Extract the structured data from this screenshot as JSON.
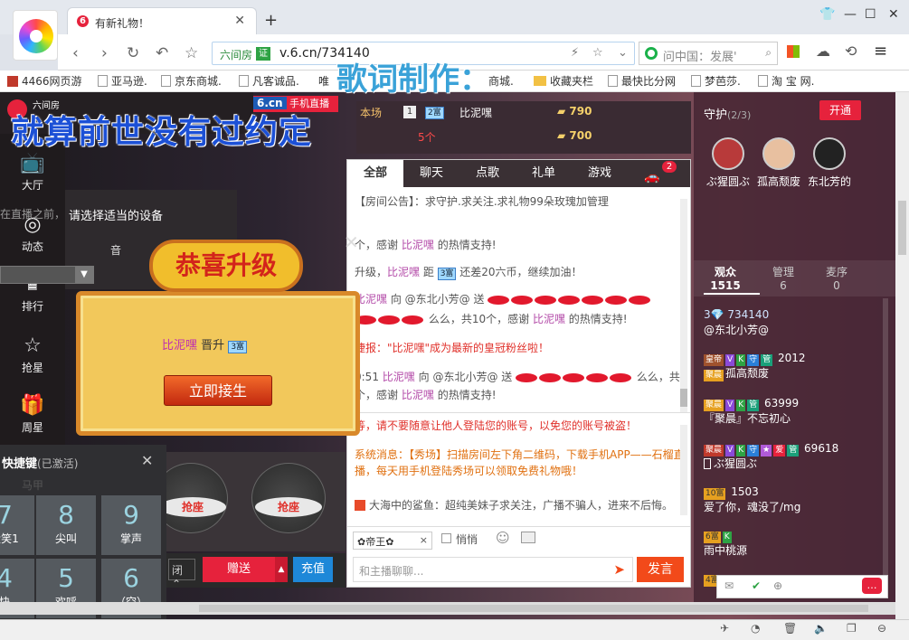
{
  "browser": {
    "tab_title": "有新礼物！",
    "tab_favicon": "6",
    "new_tab": "+",
    "url_site": "六间房",
    "url_cert": "证",
    "url": "v.6.cn/734140",
    "search_placeholder": "问中国：发展'",
    "bookmarks": [
      "4466网页游",
      "亚马逊.",
      "京东商城.",
      "凡客诚品.",
      "唯",
      "商城.",
      "收藏夹栏",
      "最快比分网",
      "梦芭莎.",
      "淘 宝 网."
    ]
  },
  "overlay": {
    "lyric_line": "就算前世没有过约定",
    "lyric_title": "歌词制作："
  },
  "brand": {
    "name": "6.cn",
    "tag": "手机直播",
    "room_label": "六间房"
  },
  "rank": {
    "label1": "本场",
    "pos": "1",
    "level_badge": "2富",
    "user": "比泥嘿",
    "gold1": "790",
    "label2": "5个",
    "gold2": "700"
  },
  "sidebar": [
    {
      "icon": "tv-icon",
      "glyph": "📺",
      "label": "大厅"
    },
    {
      "icon": "compass-icon",
      "glyph": "◎",
      "label": "动态"
    },
    {
      "icon": "crown-icon",
      "glyph": "♛",
      "label": "排行"
    },
    {
      "icon": "star-icon",
      "glyph": "☆",
      "label": "抢星"
    },
    {
      "icon": "gift-icon",
      "glyph": "🎁",
      "label": "周星"
    }
  ],
  "device_prompt": {
    "text": "请选择适当的设备",
    "hint": "在直播之前，",
    "label1": "音"
  },
  "chat_tabs": [
    "全部",
    "聊天",
    "点歌",
    "礼单",
    "游戏"
  ],
  "chat_badge": "2",
  "messages": [
    {
      "cls": "",
      "text": "【房间公告】：求守护.求关注.求礼物99朵玫瑰加管理"
    },
    {
      "cls": "",
      "pre": "个，感谢",
      "user": "比泥嘿",
      "post": "的热情支持!"
    },
    {
      "cls": "",
      "pre": "升级，",
      "user": "比泥嘿",
      "mid": "距",
      "lv": "3富",
      "post": "还差20六币，继续加油！"
    },
    {
      "cls": "",
      "user": "比泥嘿",
      "mid": "向 @东北小芳@ 送",
      "lips": 7,
      "post": ""
    },
    {
      "cls": "",
      "lips": 3,
      "pre": "么么，共10个，感谢",
      "user": "比泥嘿",
      "post": "的热情支持!"
    },
    {
      "cls": "red",
      "pre": "捷报：\"比泥嘿\"成为最新的皇冠粉丝啦！"
    },
    {
      "cls": "",
      "pre": "0:51",
      "user": "比泥嘿",
      "mid": "向 @东北小芳@ 送",
      "lips": 5,
      "post": "么么，共5"
    },
    {
      "cls": "",
      "pre": "个，感谢",
      "user": "比泥嘿",
      "post": "的热情支持!"
    },
    {
      "cls": "red",
      "pre": "等，请不要随意让他人登陆您的账号，以免您的账号被盗！"
    },
    {
      "cls": "sys",
      "pre": "系统消息：【秀场】扫描房间左下角二维码，下载手机APP——石榴直播，每天用手机登陆秀场可以领取免费礼物哦！"
    },
    {
      "cls": "",
      "pre": "大海中的鲨鱼：超纯美妹子求关注，广播不骗人，进来不后悔。"
    }
  ],
  "input": {
    "emperor": "✿帝王✿",
    "emperor_close": "×",
    "whisper": "悄悄",
    "placeholder": "和主播聊聊...",
    "send": "发言"
  },
  "guard": {
    "title": "守护",
    "count": "(2/3)",
    "open_btn": "开通",
    "members": [
      {
        "name": "ぶ猩圆ぶ",
        "color": "#b83a3a"
      },
      {
        "name": "孤高颓废",
        "color": "#e8c0a0"
      },
      {
        "name": "东北芳的",
        "color": "#222222"
      }
    ]
  },
  "audience_tabs": [
    {
      "label": "观众",
      "count": "1515"
    },
    {
      "label": "管理",
      "count": "6"
    },
    {
      "label": "麦序",
      "count": "0"
    }
  ],
  "audience": [
    {
      "line1": "3💎 734140",
      "line2": "@东北小芳@"
    },
    {
      "tags": [
        "皇帝",
        "V",
        "K",
        "守",
        "管"
      ],
      "num": "2012",
      "line2": "孤高颓废",
      "lv": "聚晨"
    },
    {
      "tags": [
        "聚晨",
        "V",
        "K",
        "管"
      ],
      "num": "63999",
      "line2": "『聚晨』不忘初心"
    },
    {
      "tags": [
        "聚晨",
        "V",
        "K",
        "守",
        "★",
        "爱",
        "管"
      ],
      "num": "69618",
      "line2": "ぶ猩圆ぶ"
    },
    {
      "tags": [
        "10富"
      ],
      "num": "1503",
      "line2": "爱了你，魂没了/mg"
    },
    {
      "tags": [
        "6富",
        "K"
      ],
      "num": "",
      "line2": "雨中桃源"
    },
    {
      "tags": [
        "4富"
      ],
      "num": "",
      "line2": ""
    }
  ],
  "popup": {
    "title": "恭喜升级",
    "user": "比泥嘿",
    "action": "晋升",
    "level": "3富",
    "button": "立即接生"
  },
  "quickkeys": {
    "title": "快捷键",
    "status": "(已激活)",
    "top_label": "马甲",
    "keys": [
      {
        "n": "7",
        "l": "大笑1"
      },
      {
        "n": "8",
        "l": "尖叫"
      },
      {
        "n": "9",
        "l": "掌声"
      },
      {
        "n": "4",
        "l": "快"
      },
      {
        "n": "5",
        "l": "欢呼"
      },
      {
        "n": "6",
        "l": "（空）"
      }
    ]
  },
  "stage": {
    "seat": "抢座",
    "gift_selector": "闭",
    "give": "赠送",
    "recharge": "充值"
  }
}
